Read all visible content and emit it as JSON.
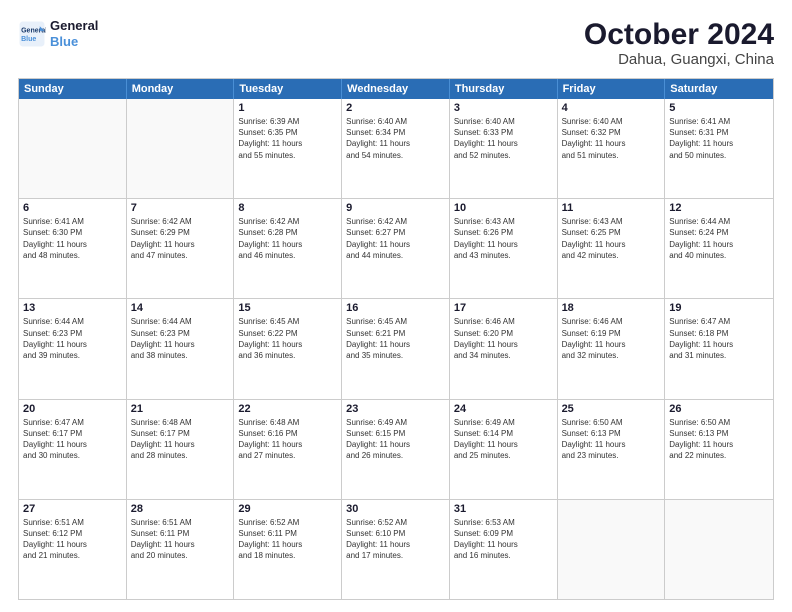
{
  "logo": {
    "line1": "General",
    "line2": "Blue"
  },
  "title": "October 2024",
  "subtitle": "Dahua, Guangxi, China",
  "days": [
    "Sunday",
    "Monday",
    "Tuesday",
    "Wednesday",
    "Thursday",
    "Friday",
    "Saturday"
  ],
  "rows": [
    [
      {
        "day": "",
        "content": ""
      },
      {
        "day": "",
        "content": ""
      },
      {
        "day": "1",
        "content": "Sunrise: 6:39 AM\nSunset: 6:35 PM\nDaylight: 11 hours\nand 55 minutes."
      },
      {
        "day": "2",
        "content": "Sunrise: 6:40 AM\nSunset: 6:34 PM\nDaylight: 11 hours\nand 54 minutes."
      },
      {
        "day": "3",
        "content": "Sunrise: 6:40 AM\nSunset: 6:33 PM\nDaylight: 11 hours\nand 52 minutes."
      },
      {
        "day": "4",
        "content": "Sunrise: 6:40 AM\nSunset: 6:32 PM\nDaylight: 11 hours\nand 51 minutes."
      },
      {
        "day": "5",
        "content": "Sunrise: 6:41 AM\nSunset: 6:31 PM\nDaylight: 11 hours\nand 50 minutes."
      }
    ],
    [
      {
        "day": "6",
        "content": "Sunrise: 6:41 AM\nSunset: 6:30 PM\nDaylight: 11 hours\nand 48 minutes."
      },
      {
        "day": "7",
        "content": "Sunrise: 6:42 AM\nSunset: 6:29 PM\nDaylight: 11 hours\nand 47 minutes."
      },
      {
        "day": "8",
        "content": "Sunrise: 6:42 AM\nSunset: 6:28 PM\nDaylight: 11 hours\nand 46 minutes."
      },
      {
        "day": "9",
        "content": "Sunrise: 6:42 AM\nSunset: 6:27 PM\nDaylight: 11 hours\nand 44 minutes."
      },
      {
        "day": "10",
        "content": "Sunrise: 6:43 AM\nSunset: 6:26 PM\nDaylight: 11 hours\nand 43 minutes."
      },
      {
        "day": "11",
        "content": "Sunrise: 6:43 AM\nSunset: 6:25 PM\nDaylight: 11 hours\nand 42 minutes."
      },
      {
        "day": "12",
        "content": "Sunrise: 6:44 AM\nSunset: 6:24 PM\nDaylight: 11 hours\nand 40 minutes."
      }
    ],
    [
      {
        "day": "13",
        "content": "Sunrise: 6:44 AM\nSunset: 6:23 PM\nDaylight: 11 hours\nand 39 minutes."
      },
      {
        "day": "14",
        "content": "Sunrise: 6:44 AM\nSunset: 6:23 PM\nDaylight: 11 hours\nand 38 minutes."
      },
      {
        "day": "15",
        "content": "Sunrise: 6:45 AM\nSunset: 6:22 PM\nDaylight: 11 hours\nand 36 minutes."
      },
      {
        "day": "16",
        "content": "Sunrise: 6:45 AM\nSunset: 6:21 PM\nDaylight: 11 hours\nand 35 minutes."
      },
      {
        "day": "17",
        "content": "Sunrise: 6:46 AM\nSunset: 6:20 PM\nDaylight: 11 hours\nand 34 minutes."
      },
      {
        "day": "18",
        "content": "Sunrise: 6:46 AM\nSunset: 6:19 PM\nDaylight: 11 hours\nand 32 minutes."
      },
      {
        "day": "19",
        "content": "Sunrise: 6:47 AM\nSunset: 6:18 PM\nDaylight: 11 hours\nand 31 minutes."
      }
    ],
    [
      {
        "day": "20",
        "content": "Sunrise: 6:47 AM\nSunset: 6:17 PM\nDaylight: 11 hours\nand 30 minutes."
      },
      {
        "day": "21",
        "content": "Sunrise: 6:48 AM\nSunset: 6:17 PM\nDaylight: 11 hours\nand 28 minutes."
      },
      {
        "day": "22",
        "content": "Sunrise: 6:48 AM\nSunset: 6:16 PM\nDaylight: 11 hours\nand 27 minutes."
      },
      {
        "day": "23",
        "content": "Sunrise: 6:49 AM\nSunset: 6:15 PM\nDaylight: 11 hours\nand 26 minutes."
      },
      {
        "day": "24",
        "content": "Sunrise: 6:49 AM\nSunset: 6:14 PM\nDaylight: 11 hours\nand 25 minutes."
      },
      {
        "day": "25",
        "content": "Sunrise: 6:50 AM\nSunset: 6:13 PM\nDaylight: 11 hours\nand 23 minutes."
      },
      {
        "day": "26",
        "content": "Sunrise: 6:50 AM\nSunset: 6:13 PM\nDaylight: 11 hours\nand 22 minutes."
      }
    ],
    [
      {
        "day": "27",
        "content": "Sunrise: 6:51 AM\nSunset: 6:12 PM\nDaylight: 11 hours\nand 21 minutes."
      },
      {
        "day": "28",
        "content": "Sunrise: 6:51 AM\nSunset: 6:11 PM\nDaylight: 11 hours\nand 20 minutes."
      },
      {
        "day": "29",
        "content": "Sunrise: 6:52 AM\nSunset: 6:11 PM\nDaylight: 11 hours\nand 18 minutes."
      },
      {
        "day": "30",
        "content": "Sunrise: 6:52 AM\nSunset: 6:10 PM\nDaylight: 11 hours\nand 17 minutes."
      },
      {
        "day": "31",
        "content": "Sunrise: 6:53 AM\nSunset: 6:09 PM\nDaylight: 11 hours\nand 16 minutes."
      },
      {
        "day": "",
        "content": ""
      },
      {
        "day": "",
        "content": ""
      }
    ]
  ]
}
